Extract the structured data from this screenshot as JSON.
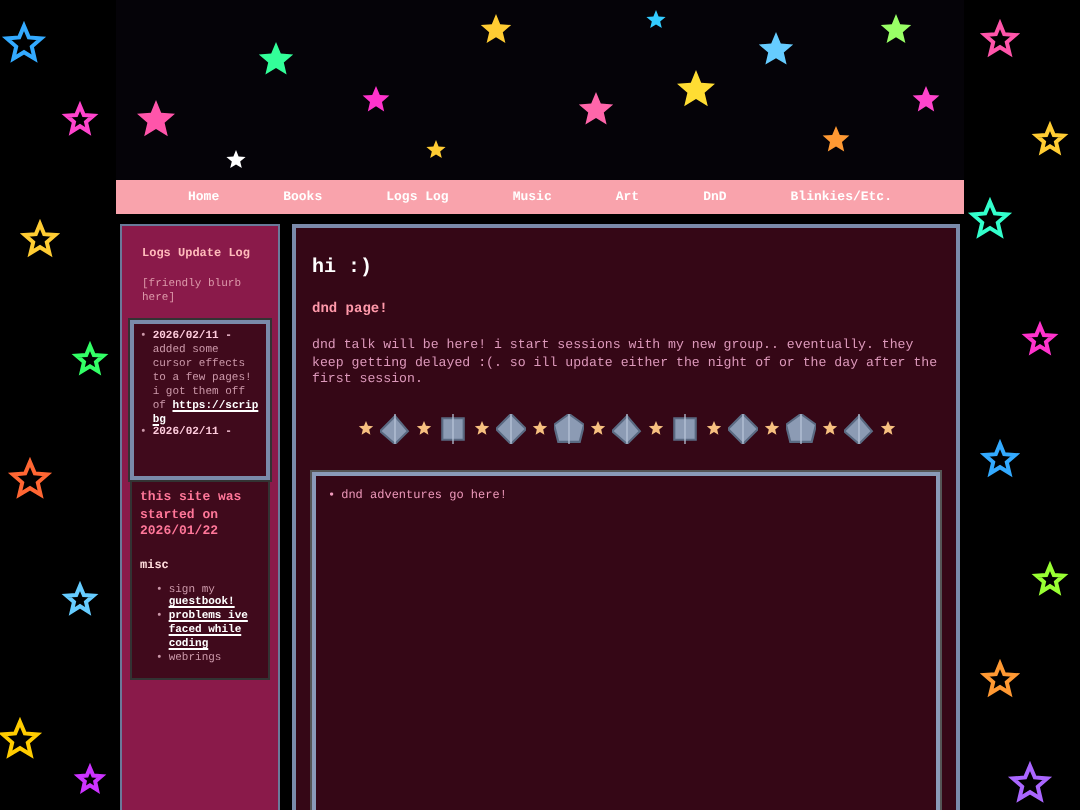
{
  "nav": [
    {
      "label": "Home"
    },
    {
      "label": "Books"
    },
    {
      "label": "Logs Log"
    },
    {
      "label": "Music"
    },
    {
      "label": "Art"
    },
    {
      "label": "DnD"
    },
    {
      "label": "Blinkies/Etc."
    }
  ],
  "sidebar": {
    "title": "Logs Update Log",
    "blurb": "[friendly blurb here]",
    "log": [
      {
        "marker": "•",
        "date": "2026/02/11 -",
        "text": "added some cursor effects to a few pages! i got them off of",
        "link": "https://scrip",
        "link_tail": "bg"
      },
      {
        "marker": "•",
        "date": "2026/02/11 -"
      }
    ],
    "started": "this site was started on 2026/01/22",
    "misc_title": "misc",
    "misc": [
      {
        "marker": "•",
        "text": "sign my",
        "link": "guestbook!"
      },
      {
        "marker": "•",
        "link": "problems ive faced while coding"
      },
      {
        "marker": "•",
        "text": "webrings"
      }
    ]
  },
  "main": {
    "title": "hi :)",
    "subtitle": "dnd page!",
    "body": "dnd talk will be here! i start sessions with my new group.. eventually. they keep getting delayed :(. so ill update either the night of or the day after the first session.",
    "adventures": [
      {
        "marker": "•",
        "text": "dnd adventures go here!"
      }
    ]
  }
}
